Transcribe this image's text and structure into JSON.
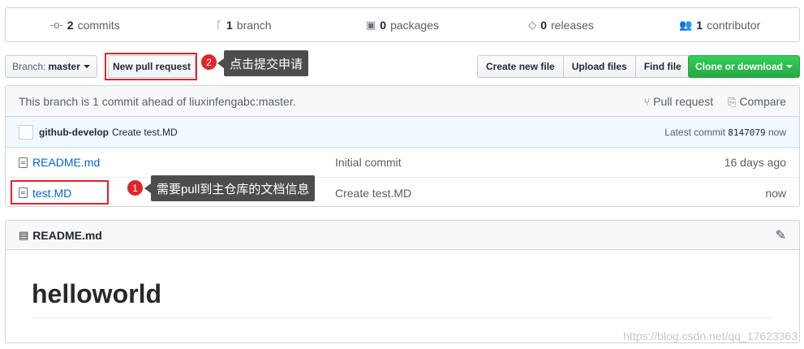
{
  "summary": {
    "commits_count": "2",
    "commits_label": "commits",
    "branch_count": "1",
    "branch_label": "branch",
    "packages_count": "0",
    "packages_label": "packages",
    "releases_count": "0",
    "releases_label": "releases",
    "contributor_count": "1",
    "contributor_label": "contributor"
  },
  "toolbar": {
    "branch_prefix": "Branch:",
    "branch_name": "master",
    "new_pr_label": "New pull request",
    "create_file_label": "Create new file",
    "upload_label": "Upload files",
    "find_label": "Find file",
    "clone_label": "Clone or download"
  },
  "annotations": {
    "one_number": "1",
    "one_text": "需要pull到主仓库的文档信息",
    "two_number": "2",
    "two_text": "点击提交申请"
  },
  "branch_info": {
    "text": "This branch is 1 commit ahead of liuxinfengabc:master.",
    "pull_request_label": "Pull request",
    "compare_label": "Compare"
  },
  "latest_commit": {
    "author": "github-develop",
    "message": "Create test.MD",
    "label": "Latest commit",
    "sha": "8147079",
    "age": "now"
  },
  "files": [
    {
      "name": "README.md",
      "message": "Initial commit",
      "age": "16 days ago"
    },
    {
      "name": "test.MD",
      "message": "Create test.MD",
      "age": "now"
    }
  ],
  "readme": {
    "title": "README.md",
    "heading": "helloworld"
  },
  "watermark": "https://blog.csdn.net/qq_17623363",
  "colors": {
    "accent_red": "#e0252b",
    "link_blue": "#0366d6",
    "green_button": "#28a745"
  }
}
